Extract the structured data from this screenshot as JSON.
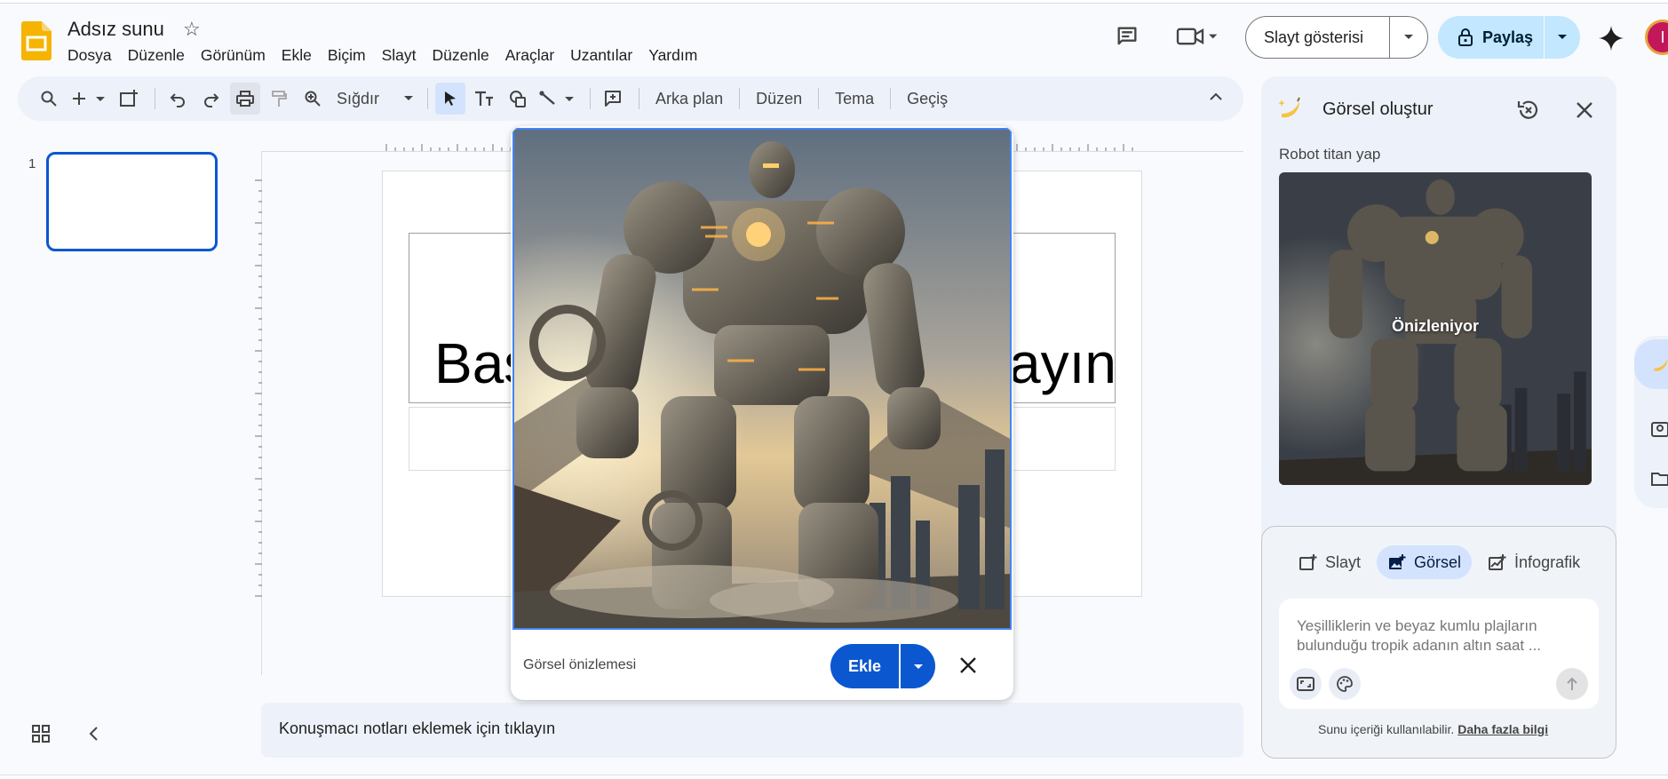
{
  "app": {
    "doc_title": "Adsız sunu",
    "menu": [
      "Dosya",
      "Düzenle",
      "Görünüm",
      "Ekle",
      "Biçim",
      "Slayt",
      "Düzenle",
      "Araçlar",
      "Uzantılar",
      "Yardım"
    ],
    "slideshow_label": "Slayt gösterisi",
    "share_label": "Paylaş",
    "avatar_initial": "I"
  },
  "toolbar": {
    "zoom_label": "Sığdır",
    "background_label": "Arka plan",
    "layout_label": "Düzen",
    "theme_label": "Tema",
    "transition_label": "Geçiş"
  },
  "filmstrip": {
    "slide_number": "1"
  },
  "slide": {
    "title_left": "Baş",
    "title_right": "ayın"
  },
  "notes": {
    "placeholder": "Konuşmacı notları eklemek için tıklayın"
  },
  "preview_popup": {
    "label": "Görsel önizlemesi",
    "insert_label": "Ekle"
  },
  "side_panel": {
    "title": "Görsel oluştur",
    "prompt": "Robot titan yap",
    "previewing_label": "Önizleniyor",
    "tabs": [
      {
        "label": "Slayt"
      },
      {
        "label": "Görsel"
      },
      {
        "label": "İnfografik"
      }
    ],
    "input_placeholder": "Yeşilliklerin ve beyaz kumlu plajların bulunduğu tropik adanın altın saat ...",
    "disclaimer": "Sunu içeriği kullanılabilir.",
    "learn_more": "Daha fazla bilgi"
  },
  "colors": {
    "accent": "#0b57d0",
    "share_bg": "#c2e7ff",
    "active_tab": "#d3e3fd"
  }
}
